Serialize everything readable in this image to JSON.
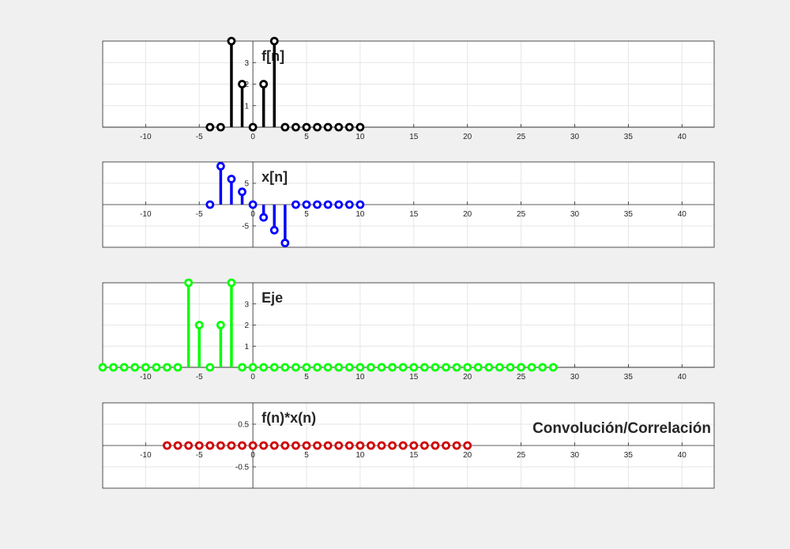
{
  "chart_data": [
    {
      "type": "stem",
      "title": "f[n]",
      "color": "#000000",
      "xlim": [
        -14,
        43
      ],
      "ylim": [
        0,
        4
      ],
      "xticks": [
        -10,
        -5,
        0,
        5,
        10,
        15,
        20,
        25,
        30,
        35,
        40
      ],
      "yticks": [
        1,
        2,
        3
      ],
      "grid": true,
      "x": [
        -4,
        -3,
        -2,
        -1,
        0,
        1,
        2,
        3,
        4,
        5,
        6,
        7,
        8,
        9,
        10
      ],
      "y": [
        0,
        0,
        4,
        2,
        0,
        2,
        4,
        0,
        0,
        0,
        0,
        0,
        0,
        0,
        0
      ]
    },
    {
      "type": "stem",
      "title": "x[n]",
      "color": "#0000ff",
      "xlim": [
        -14,
        43
      ],
      "ylim": [
        -10,
        10
      ],
      "xticks": [
        -10,
        -5,
        0,
        5,
        10,
        15,
        20,
        25,
        30,
        35,
        40
      ],
      "yticks": [
        -5,
        5
      ],
      "grid": true,
      "x": [
        -4,
        -3,
        -2,
        -1,
        0,
        1,
        2,
        3,
        4,
        5,
        6,
        7,
        8,
        9,
        10
      ],
      "y": [
        0,
        9,
        6,
        3,
        0,
        -3,
        -6,
        -9,
        0,
        0,
        0,
        0,
        0,
        0,
        0
      ]
    },
    {
      "type": "stem",
      "title": "Eje",
      "color": "#00ff00",
      "xlim": [
        -14,
        43
      ],
      "ylim": [
        0,
        4
      ],
      "xticks": [
        -10,
        -5,
        0,
        5,
        10,
        15,
        20,
        25,
        30,
        35,
        40
      ],
      "yticks": [
        1,
        2,
        3
      ],
      "grid": true,
      "x": [
        -14,
        -13,
        -12,
        -11,
        -10,
        -9,
        -8,
        -7,
        -6,
        -5,
        -4,
        -3,
        -2,
        -1,
        0,
        1,
        2,
        3,
        4,
        5,
        6,
        7,
        8,
        9,
        10,
        11,
        12,
        13,
        14,
        15,
        16,
        17,
        18,
        19,
        20,
        21,
        22,
        23,
        24,
        25,
        26,
        27,
        28
      ],
      "y": [
        0,
        0,
        0,
        0,
        0,
        0,
        0,
        0,
        4,
        2,
        0,
        2,
        4,
        0,
        0,
        0,
        0,
        0,
        0,
        0,
        0,
        0,
        0,
        0,
        0,
        0,
        0,
        0,
        0,
        0,
        0,
        0,
        0,
        0,
        0,
        0,
        0,
        0,
        0,
        0,
        0,
        0,
        0
      ]
    },
    {
      "type": "stem",
      "title": "f(n)*x(n)",
      "annotation": "Convolución/Correlación",
      "color": "#d00000",
      "xlim": [
        -14,
        43
      ],
      "ylim": [
        -1,
        1
      ],
      "xticks": [
        -10,
        -5,
        0,
        5,
        10,
        15,
        20,
        25,
        30,
        35,
        40
      ],
      "yticks": [
        -0.5,
        0.5
      ],
      "grid": true,
      "x": [
        -8,
        -7,
        -6,
        -5,
        -4,
        -3,
        -2,
        -1,
        0,
        1,
        2,
        3,
        4,
        5,
        6,
        7,
        8,
        9,
        10,
        11,
        12,
        13,
        14,
        15,
        16,
        17,
        18,
        19,
        20
      ],
      "y": [
        0,
        0,
        0,
        0,
        0,
        0,
        0,
        0,
        0,
        0,
        0,
        0,
        0,
        0,
        0,
        0,
        0,
        0,
        0,
        0,
        0,
        0,
        0,
        0,
        0,
        0,
        0,
        0,
        0
      ]
    }
  ]
}
